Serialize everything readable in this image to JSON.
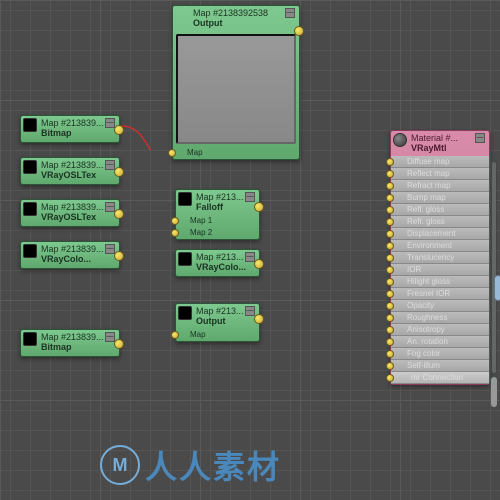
{
  "big_preview": {
    "title": "Map #2138392538",
    "subtitle": "Output",
    "slot": "Map"
  },
  "left_nodes": [
    {
      "title": "Map #213839...",
      "subtitle": "Bitmap"
    },
    {
      "title": "Map #213839...",
      "subtitle": "VRayOSLTex"
    },
    {
      "title": "Map #213839...",
      "subtitle": "VRayOSLTex"
    },
    {
      "title": "Map #213839...",
      "subtitle": "VRayColo..."
    },
    {
      "title": "Map #213839...",
      "subtitle": "Bitmap"
    }
  ],
  "mid_nodes": [
    {
      "title": "Map #213...",
      "subtitle": "Falloff",
      "slots": [
        "Map 1",
        "Map 2"
      ]
    },
    {
      "title": "Map #213...",
      "subtitle": "VRayColo..."
    },
    {
      "title": "Map #213...",
      "subtitle": "Output",
      "slots": [
        "Map"
      ]
    }
  ],
  "material": {
    "title": "Material #...",
    "subtitle": "VRayMtl",
    "slots": [
      "Diffuse map",
      "Reflect map",
      "Refract map",
      "Bump map",
      "Refl. gloss",
      "Refr. gloss",
      "Displacement",
      "Environment",
      "Translucency",
      "IOR",
      "Hilight gloss",
      "Fresnel IOR",
      "Opacity",
      "Roughness",
      "Anisotropy",
      "An. rotation",
      "Fog color",
      "Self-illum",
      "mr Connection"
    ]
  },
  "watermark": {
    "logo": "M",
    "text": "人人素材"
  },
  "minimize": "—"
}
